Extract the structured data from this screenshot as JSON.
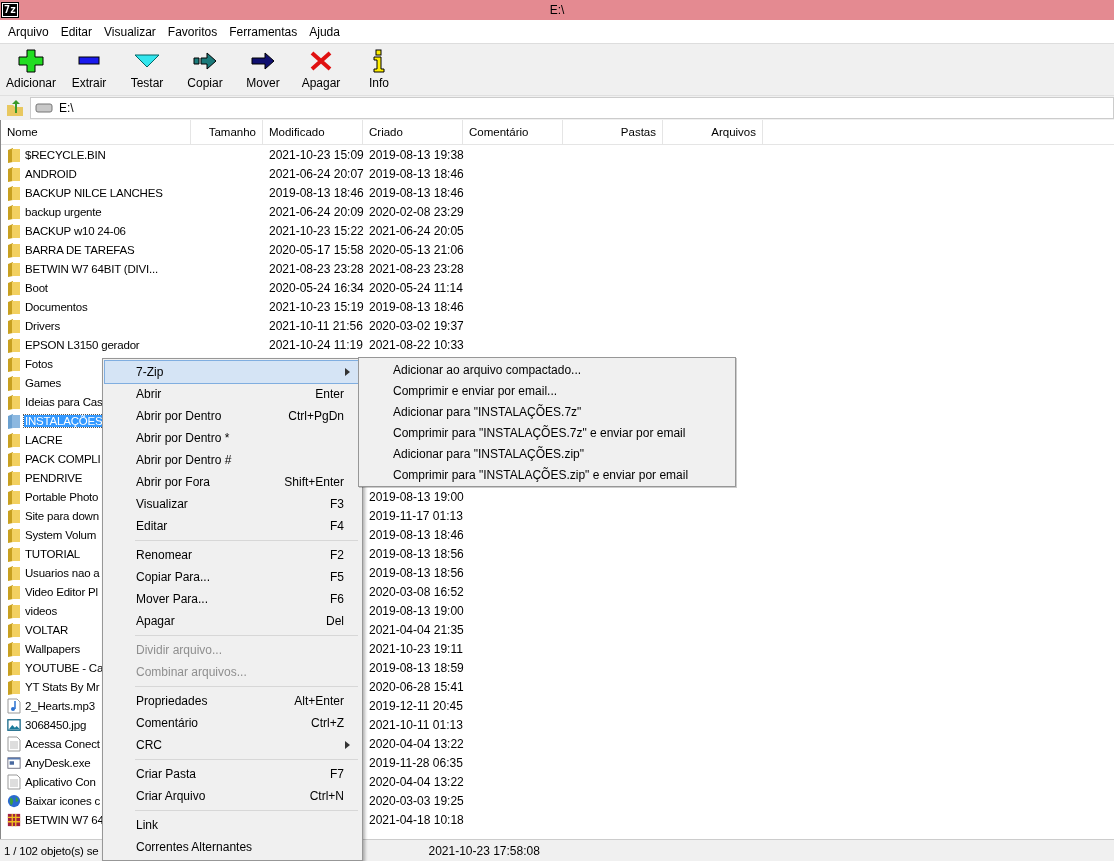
{
  "window": {
    "app_icon": "7z",
    "title": "E:\\"
  },
  "menu_bar": [
    "Arquivo",
    "Editar",
    "Visualizar",
    "Favoritos",
    "Ferramentas",
    "Ajuda"
  ],
  "toolbar": [
    {
      "kind": "add",
      "label": "Adicionar"
    },
    {
      "kind": "extract",
      "label": "Extrair"
    },
    {
      "kind": "test",
      "label": "Testar"
    },
    {
      "kind": "copy",
      "label": "Copiar"
    },
    {
      "kind": "move",
      "label": "Mover"
    },
    {
      "kind": "delete",
      "label": "Apagar"
    },
    {
      "kind": "info",
      "label": "Info"
    }
  ],
  "address": {
    "value": "E:\\"
  },
  "table": {
    "columns": [
      "Nome",
      "Tamanho",
      "Modificado",
      "Criado",
      "Comentário",
      "Pastas",
      "Arquivos"
    ],
    "rows": [
      {
        "kind": "folder",
        "name": "$RECYCLE.BIN",
        "modified": "2021-10-23 15:09",
        "created": "2019-08-13 19:38",
        "selected": false
      },
      {
        "kind": "folder",
        "name": "ANDROID",
        "modified": "2021-06-24 20:07",
        "created": "2019-08-13 18:46",
        "selected": false
      },
      {
        "kind": "folder",
        "name": "BACKUP NILCE LANCHES",
        "modified": "2019-08-13 18:46",
        "created": "2019-08-13 18:46",
        "selected": false
      },
      {
        "kind": "folder",
        "name": "backup urgente",
        "modified": "2021-06-24 20:09",
        "created": "2020-02-08 23:29",
        "selected": false
      },
      {
        "kind": "folder",
        "name": "BACKUP w10 24-06",
        "modified": "2021-10-23 15:22",
        "created": "2021-06-24 20:05",
        "selected": false
      },
      {
        "kind": "folder",
        "name": "BARRA DE TAREFAS",
        "modified": "2020-05-17 15:58",
        "created": "2020-05-13 21:06",
        "selected": false
      },
      {
        "kind": "folder",
        "name": "BETWIN W7 64BIT  (DIVI...",
        "modified": "2021-08-23 23:28",
        "created": "2021-08-23 23:28",
        "selected": false
      },
      {
        "kind": "folder",
        "name": "Boot",
        "modified": "2020-05-24 16:34",
        "created": "2020-05-24 11:14",
        "selected": false
      },
      {
        "kind": "folder",
        "name": "Documentos",
        "modified": "2021-10-23 15:19",
        "created": "2019-08-13 18:46",
        "selected": false
      },
      {
        "kind": "folder",
        "name": "Drivers",
        "modified": "2021-10-11 21:56",
        "created": "2020-03-02 19:37",
        "selected": false
      },
      {
        "kind": "folder",
        "name": "EPSON L3150 gerador",
        "modified": "2021-10-24 11:19",
        "created": "2021-08-22 10:33",
        "selected": false
      },
      {
        "kind": "folder",
        "name": "Fotos",
        "selected": false
      },
      {
        "kind": "folder",
        "name": "Games",
        "selected": false
      },
      {
        "kind": "folder",
        "name": "Ideias para Cas",
        "selected": false
      },
      {
        "kind": "folder",
        "name": "INSTALAÇÕES",
        "selected": true
      },
      {
        "kind": "folder",
        "name": "LACRE",
        "selected": false
      },
      {
        "kind": "folder",
        "name": "PACK COMPLI",
        "selected": false
      },
      {
        "kind": "folder",
        "name": "PENDRIVE",
        "selected": false
      },
      {
        "kind": "folder",
        "name": "Portable Photo",
        "created": "2019-08-13 19:00",
        "selected": false
      },
      {
        "kind": "folder",
        "name": "Site para down",
        "created": "2019-11-17 01:13",
        "selected": false
      },
      {
        "kind": "folder",
        "name": "System Volum",
        "created": "2019-08-13 18:46",
        "selected": false
      },
      {
        "kind": "folder",
        "name": "TUTORIAL",
        "created": "2019-08-13 18:56",
        "selected": false
      },
      {
        "kind": "folder",
        "name": "Usuarios nao a",
        "created": "2019-08-13 18:56",
        "selected": false
      },
      {
        "kind": "folder",
        "name": "Video Editor Pl",
        "created": "2020-03-08 16:52",
        "selected": false
      },
      {
        "kind": "folder",
        "name": "videos",
        "created": "2019-08-13 19:00",
        "selected": false
      },
      {
        "kind": "folder",
        "name": "VOLTAR",
        "created": "2021-04-04 21:35",
        "selected": false
      },
      {
        "kind": "folder",
        "name": "Wallpapers",
        "created": "2021-10-23 19:11",
        "selected": false
      },
      {
        "kind": "folder",
        "name": "YOUTUBE - Ca",
        "created": "2019-08-13 18:59",
        "selected": false
      },
      {
        "kind": "folder",
        "name": "YT Stats By Mr",
        "created": "2020-06-28 15:41",
        "selected": false
      },
      {
        "kind": "audio",
        "name": "2_Hearts.mp3",
        "created": "2019-12-11 20:45",
        "selected": false
      },
      {
        "kind": "image",
        "name": "3068450.jpg",
        "created": "2021-10-11 01:13",
        "selected": false
      },
      {
        "kind": "text",
        "name": "Acessa Conect",
        "created": "2020-04-04 13:22",
        "selected": false
      },
      {
        "kind": "exe",
        "name": "AnyDesk.exe",
        "created": "2019-11-28 06:35",
        "selected": false
      },
      {
        "kind": "text",
        "name": "Aplicativo Con",
        "created": "2020-04-04 13:22",
        "selected": false
      },
      {
        "kind": "web",
        "name": "Baixar icones c",
        "created": "2020-03-03 19:25",
        "selected": false
      },
      {
        "kind": "archive",
        "name": "BETWIN W7 64",
        "created": "2021-04-18 10:18",
        "selected": false
      }
    ]
  },
  "context_menu": {
    "items": [
      {
        "kind": "item",
        "label": "7-Zip",
        "submenu": true,
        "selected": true,
        "disabled": false
      },
      {
        "kind": "item",
        "label": "Abrir",
        "shortcut": "Enter",
        "submenu": false,
        "selected": false,
        "disabled": false
      },
      {
        "kind": "item",
        "label": "Abrir por Dentro",
        "shortcut": "Ctrl+PgDn",
        "submenu": false,
        "selected": false,
        "disabled": false
      },
      {
        "kind": "item",
        "label": "Abrir por Dentro *",
        "submenu": false,
        "selected": false,
        "disabled": false
      },
      {
        "kind": "item",
        "label": "Abrir por Dentro #",
        "submenu": false,
        "selected": false,
        "disabled": false
      },
      {
        "kind": "item",
        "label": "Abrir por Fora",
        "shortcut": "Shift+Enter",
        "submenu": false,
        "selected": false,
        "disabled": false
      },
      {
        "kind": "item",
        "label": "Visualizar",
        "shortcut": "F3",
        "submenu": false,
        "selected": false,
        "disabled": false
      },
      {
        "kind": "item",
        "label": "Editar",
        "shortcut": "F4",
        "submenu": false,
        "selected": false,
        "disabled": false
      },
      {
        "kind": "separator"
      },
      {
        "kind": "item",
        "label": "Renomear",
        "shortcut": "F2",
        "submenu": false,
        "selected": false,
        "disabled": false
      },
      {
        "kind": "item",
        "label": "Copiar Para...",
        "shortcut": "F5",
        "submenu": false,
        "selected": false,
        "disabled": false
      },
      {
        "kind": "item",
        "label": "Mover Para...",
        "shortcut": "F6",
        "submenu": false,
        "selected": false,
        "disabled": false
      },
      {
        "kind": "item",
        "label": "Apagar",
        "shortcut": "Del",
        "submenu": false,
        "selected": false,
        "disabled": false
      },
      {
        "kind": "separator"
      },
      {
        "kind": "item",
        "label": "Dividir arquivo...",
        "submenu": false,
        "selected": false,
        "disabled": true
      },
      {
        "kind": "item",
        "label": "Combinar arquivos...",
        "submenu": false,
        "selected": false,
        "disabled": true
      },
      {
        "kind": "separator"
      },
      {
        "kind": "item",
        "label": "Propriedades",
        "shortcut": "Alt+Enter",
        "submenu": false,
        "selected": false,
        "disabled": false
      },
      {
        "kind": "item",
        "label": "Comentário",
        "shortcut": "Ctrl+Z",
        "submenu": false,
        "selected": false,
        "disabled": false
      },
      {
        "kind": "item",
        "label": "CRC",
        "submenu": true,
        "selected": false,
        "disabled": false
      },
      {
        "kind": "separator"
      },
      {
        "kind": "item",
        "label": "Criar Pasta",
        "shortcut": "F7",
        "submenu": false,
        "selected": false,
        "disabled": false
      },
      {
        "kind": "item",
        "label": "Criar Arquivo",
        "shortcut": "Ctrl+N",
        "submenu": false,
        "selected": false,
        "disabled": false
      },
      {
        "kind": "separator"
      },
      {
        "kind": "item",
        "label": "Link",
        "submenu": false,
        "selected": false,
        "disabled": false
      },
      {
        "kind": "item",
        "label": "Correntes Alternantes",
        "submenu": false,
        "selected": false,
        "disabled": false
      }
    ]
  },
  "submenu": {
    "items": [
      "Adicionar ao arquivo compactado...",
      "Comprimir e enviar por email...",
      "Adicionar para \"INSTALAÇÕES.7z\"",
      "Comprimir para \"INSTALAÇÕES.7z\" e enviar por email",
      "Adicionar para \"INSTALAÇÕES.zip\"",
      "Comprimir para \"INSTALAÇÕES.zip\" e enviar por email"
    ]
  },
  "status_bar": [
    "1 / 102 objeto(s) se",
    "2021-10-23 17:58:08"
  ]
}
